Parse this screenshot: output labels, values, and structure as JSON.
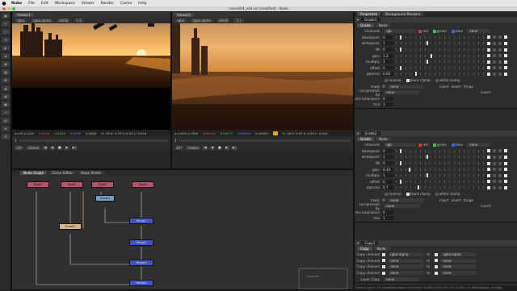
{
  "menubar": {
    "apple": "",
    "items": [
      "Nuke",
      "File",
      "Edit",
      "Workspace",
      "Viewer",
      "Render",
      "Cache",
      "Help"
    ]
  },
  "window": {
    "title": "course04_v04.nk [modified] - Nuke"
  },
  "viewer1": {
    "tab": "Viewer1",
    "channels": "rgba",
    "layer": "rgba.alpha",
    "colorspace": "sRGB",
    "zoom": "1:1",
    "status": {
      "coords": "x=55 y=242",
      "r": "0.0326",
      "g": "0.0135",
      "b": "0.0035",
      "a": "0.0000",
      "extra": "H: 16 S: 0.75 V: 0.03 L: 0.016"
    },
    "frame": "1",
    "fps": "24*",
    "mode": "Global"
  },
  "viewer2": {
    "tab": "Viewer2",
    "channels": "rgba",
    "layer": "rgba.alpha",
    "colorspace": "sRGB",
    "zoom": "1:1",
    "status": {
      "coords": "x=1509 y=306",
      "r": "0.99118",
      "g": "0.29177",
      "b": "0.00000",
      "a": "0.00000",
      "extra": "H: 18 S: 0.97 V: 0.99 L: 0.442"
    },
    "frame": "1",
    "fps": "24*",
    "mode": "Global"
  },
  "nodegraph": {
    "tabs": [
      "Node Graph",
      "Curve Editor",
      "Dope Sheet"
    ],
    "nodes": [
      {
        "label": "Read1",
        "color": "#b3546a"
      },
      {
        "label": "Read2",
        "color": "#b3546a"
      },
      {
        "label": "Read3",
        "color": "#b3546a"
      },
      {
        "label": "Read4",
        "color": "#b3546a"
      },
      {
        "label": "Grade1",
        "color": "#7aa0c8"
      },
      {
        "label": "Merge1",
        "color": "#4055c0"
      },
      {
        "label": "Grade2",
        "color": "#d9b98c"
      },
      {
        "label": "Merge2",
        "color": "#4055c0"
      },
      {
        "label": "Merge3",
        "color": "#4055c0"
      },
      {
        "label": "Merge4",
        "color": "#4055c0"
      }
    ]
  },
  "properties": {
    "tabs": [
      "Properties",
      "Background Renders"
    ],
    "grade1": {
      "name": "Grade1",
      "subtabs": [
        "Grade",
        "Node"
      ],
      "channels_value": "rgb",
      "channel_checks": [
        "red",
        "green",
        "blue"
      ],
      "channel_dd": "none",
      "rows": [
        {
          "label": "blackpoint",
          "value": "0",
          "knob": 0.05
        },
        {
          "label": "whitepoint",
          "value": "1",
          "knob": 0.35
        },
        {
          "label": "lift",
          "value": "0",
          "knob": 0.05
        },
        {
          "label": "gain",
          "value": "1.2",
          "knob": 0.4
        },
        {
          "label": "multiply",
          "value": "1",
          "knob": 0.35
        },
        {
          "label": "offset",
          "value": "0",
          "knob": 0.05
        },
        {
          "label": "gamma",
          "value": "0.62",
          "knob": 0.22
        }
      ],
      "reverse": "reverse",
      "black_clamp": "black clamp",
      "white_clamp": "white clamp",
      "mask": "mask",
      "mask_dd": "none",
      "inject": "inject",
      "invert": "invert",
      "fringe": "fringe",
      "unpremult_label": "(un)premult by",
      "unpremult_dd": "none",
      "invert2": "invert",
      "mix_luminance_label": "mix luminance",
      "mix_luminance": "0",
      "mix_label": "mix",
      "mix": "1"
    },
    "grade2": {
      "name": "Grade2",
      "subtabs": [
        "Grade",
        "Node"
      ],
      "channels_value": "rgb",
      "channel_checks": [
        "red",
        "green",
        "blue"
      ],
      "channel_dd": "none",
      "rows": [
        {
          "label": "blackpoint",
          "value": "0",
          "knob": 0.05
        },
        {
          "label": "whitepoint",
          "value": "1",
          "knob": 0.35
        },
        {
          "label": "lift",
          "value": "0",
          "knob": 0.05
        },
        {
          "label": "gain",
          "value": "0.33",
          "knob": 0.15
        },
        {
          "label": "multiply",
          "value": "1",
          "knob": 0.35
        },
        {
          "label": "offset",
          "value": "0",
          "knob": 0.05
        },
        {
          "label": "gamma",
          "value": "0.7",
          "knob": 0.25
        }
      ],
      "reverse": "reverse",
      "black_clamp": "black clamp",
      "white_clamp": "white clamp",
      "mask": "mask",
      "mask_dd": "none",
      "inject": "inject",
      "invert": "invert",
      "fringe": "fringe",
      "unpremult_label": "(un)premult by",
      "unpremult_dd": "none",
      "invert2": "invert",
      "mix_luminance_label": "mix luminance",
      "mix_luminance": "0",
      "mix_label": "mix",
      "mix": "1"
    },
    "copy1": {
      "name": "Copy1",
      "subtabs": [
        "Copy",
        "Node"
      ],
      "rows": [
        {
          "label": "Copy channel",
          "from": "rgba.alpha",
          "to_label": "to",
          "to": "rgba.alpha"
        },
        {
          "label": "Copy channel",
          "from": "none",
          "to_label": "to",
          "to": "none"
        },
        {
          "label": "Copy channel",
          "from": "none",
          "to_label": "to",
          "to": "none"
        },
        {
          "label": "Copy channel",
          "from": "none",
          "to_label": "to",
          "to": "none"
        }
      ],
      "layer_copy": "Layer Copy",
      "layer_dd": "none"
    }
  },
  "statusbar": {
    "text": "Channel Count: 114  Localization Mode: On  Memory: 3.9 GB (24.3%)  CPU: 31.7%  Disk: 0.1 MB/s  Network: 0.0 MB/s"
  },
  "colors": {
    "accent": "#f0a030",
    "read_node": "#b3546a",
    "merge_node": "#4055c0"
  }
}
